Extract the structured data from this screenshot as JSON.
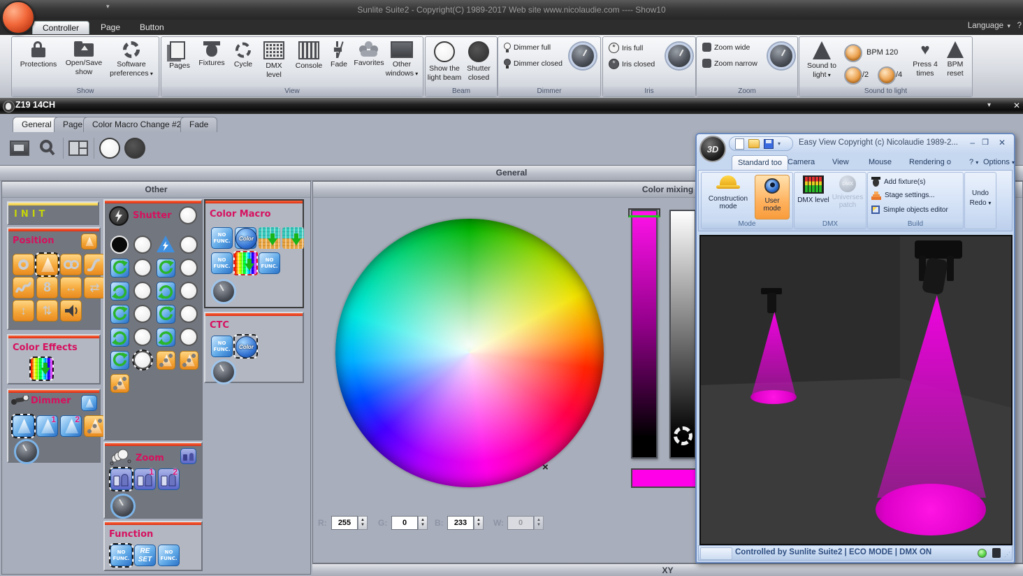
{
  "titlebar": {
    "title": "Sunlite Suite2 - Copyright(C) 1989-2017    Web site www.nicolaudie.com ---- Show10"
  },
  "menubar": {
    "tabs": [
      "Controller",
      "Page",
      "Button"
    ],
    "language": "Language",
    "help": "?"
  },
  "ribbon": {
    "show": {
      "label": "Show",
      "protections": "Protections",
      "open_save": "Open/Save show",
      "software_prefs": "Software preferences"
    },
    "view": {
      "label": "View",
      "pages": "Pages",
      "fixtures": "Fixtures",
      "cycle": "Cycle",
      "dmx_level": "DMX level",
      "console": "Console",
      "fade": "Fade",
      "favorites": "Favorites",
      "other_windows": "Other windows"
    },
    "beam": {
      "label": "Beam",
      "show_beam": "Show the light beam",
      "shutter_closed": "Shutter closed"
    },
    "dimmer": {
      "label": "Dimmer",
      "full": "Dimmer full",
      "closed": "Dimmer closed"
    },
    "iris": {
      "label": "Iris",
      "full": "Iris full",
      "closed": "Iris closed"
    },
    "zoom": {
      "label": "Zoom",
      "wide": "Zoom wide",
      "narrow": "Zoom narrow"
    },
    "sound": {
      "label": "Sound to light",
      "sound_to_light": "Sound to light",
      "bpm": "BPM 120",
      "div2": "/2",
      "div4": "/4",
      "press": "Press 4 times",
      "reset": "BPM reset"
    }
  },
  "fixture_window": {
    "title": "Z19 14CH",
    "tabs": [
      "General",
      "Page",
      "Color Macro Change #2",
      "Fade"
    ],
    "section_header": "General"
  },
  "other_panel": {
    "title": "Other",
    "init": {
      "title": "INIT"
    },
    "position": {
      "title": "Position"
    },
    "color_effects": {
      "title": "Color Effects"
    },
    "dimmer": {
      "title": "Dimmer",
      "btn1": "1",
      "btn2": "2"
    },
    "shutter": {
      "title": "Shutter"
    },
    "zoom": {
      "title": "Zoom",
      "btn1": "1",
      "btn2": "2"
    },
    "function": {
      "title": "Function",
      "no_func": "NO FUNC.",
      "reset_line1": "RE",
      "reset_line2": "SET"
    },
    "color_macro": {
      "title": "Color Macro",
      "no_func": "NO FUNC.",
      "color_label": "Color"
    },
    "ctc": {
      "title": "CTC",
      "no_func": "NO FUNC.",
      "color_label": "Color"
    }
  },
  "color_mixing": {
    "title": "Color mixing",
    "r_label": "R:",
    "g_label": "G:",
    "b_label": "B:",
    "w_label": "W:",
    "r": "255",
    "g": "0",
    "b": "233",
    "w": "0",
    "selected_color": "#FF00E9"
  },
  "xy_panel": {
    "title": "XY"
  },
  "easy_view": {
    "logo": "3D",
    "title": "Easy View   Copyright (c) Nicolaudie 1989-2...",
    "tabs": [
      "Standard too",
      "Camera",
      "View",
      "Mouse",
      "Rendering o"
    ],
    "help": "?",
    "options": "Options",
    "mode": {
      "label": "Mode",
      "construction": "Construction mode",
      "user": "User mode"
    },
    "dmx": {
      "label": "DMX",
      "dmx_level": "DMX level",
      "universes": "Universes patch",
      "universes_icon_text": "DMX"
    },
    "build": {
      "label": "Build",
      "add": "Add fixture(s)",
      "stage": "Stage settings...",
      "simple": "Simple objects editor"
    },
    "undo": "Undo",
    "redo": "Redo",
    "status": "Controlled by Sunlite Suite2  |  ECO MODE  |  DMX ON"
  }
}
